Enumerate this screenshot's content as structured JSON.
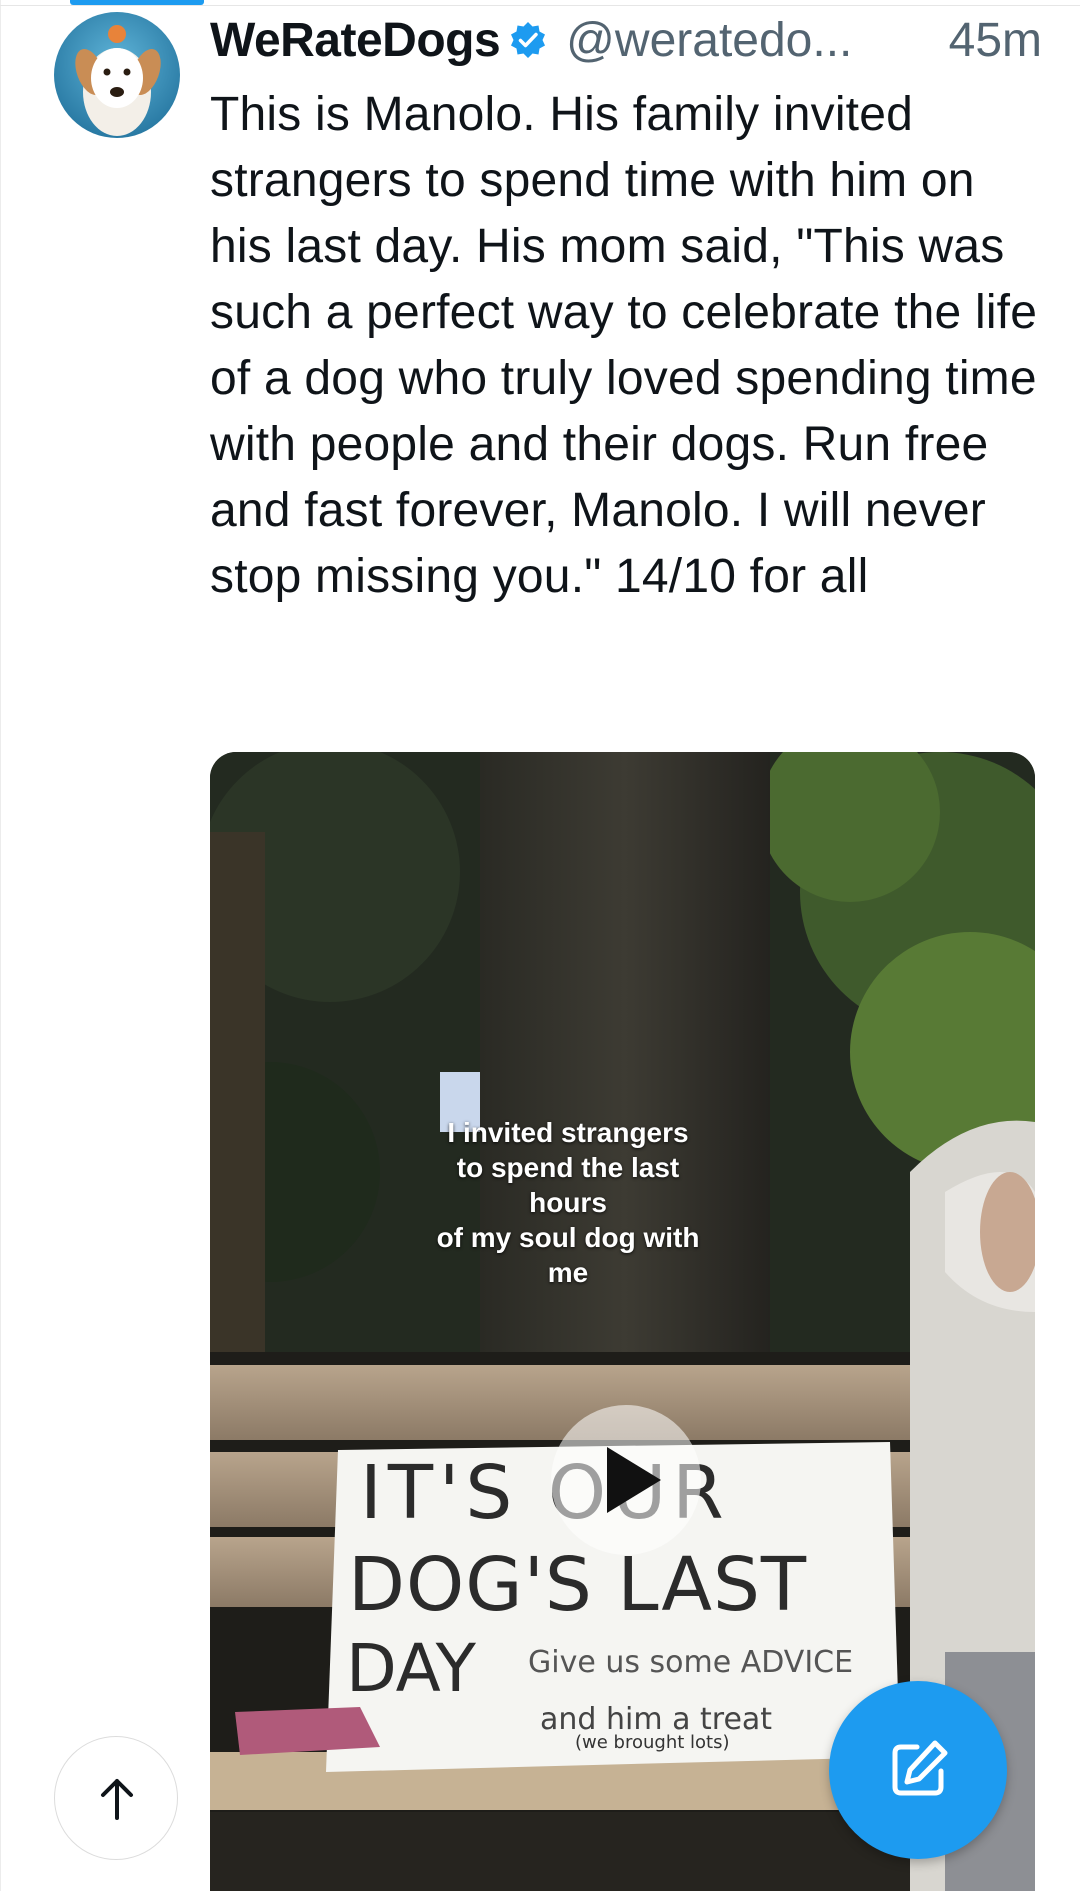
{
  "tweet": {
    "display_name": "WeRateDogs",
    "handle": "@weratedo...",
    "time": "45m",
    "verified": true,
    "text": "This is Manolo. His family invited strangers to spend time with him on his last day. His mom said, \"This was such a perfect way to celebrate the life of a dog who truly loved spending time with people and their dogs. Run free and fast forever, Manolo. I will never stop missing you.\" 14/10 for all"
  },
  "media": {
    "type": "video",
    "caption_lines": [
      "I invited strangers",
      "to spend the last hours",
      "of my soul dog with me"
    ],
    "sign_lines": [
      "IT'S OUR",
      "DOG'S LAST",
      "DAY",
      "Give us some ADVICE",
      "and him a treat",
      "(we brought lots)"
    ]
  },
  "icons": {
    "verified": "verified-badge-icon",
    "play": "play-icon",
    "scroll_top": "arrow-up-icon",
    "compose": "compose-icon"
  },
  "colors": {
    "accent": "#1d9bf0",
    "text_primary": "#0f1419",
    "text_secondary": "#536471"
  }
}
